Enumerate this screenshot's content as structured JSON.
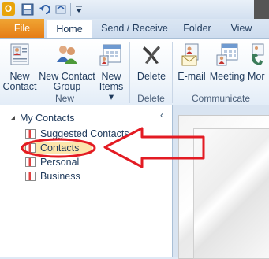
{
  "tabs": {
    "file": "File",
    "home": "Home",
    "send_receive": "Send / Receive",
    "folder": "Folder",
    "view": "View"
  },
  "ribbon": {
    "new_contact": [
      "New",
      "Contact"
    ],
    "new_contact_group": [
      "New Contact",
      "Group"
    ],
    "new_items": [
      "New",
      "Items ▾"
    ],
    "delete": "Delete",
    "email": "E-mail",
    "meeting": "Meeting",
    "more": "Mor",
    "groups": {
      "new": "New",
      "delete": "Delete",
      "communicate": "Communicate"
    }
  },
  "nav": {
    "collapse_glyph": "‹",
    "section_title": "My Contacts",
    "items": [
      "Suggested Contacts",
      "Contacts",
      "Personal",
      "Business"
    ],
    "selected": "Contacts"
  },
  "annotation": {
    "color": "#e31b23"
  }
}
